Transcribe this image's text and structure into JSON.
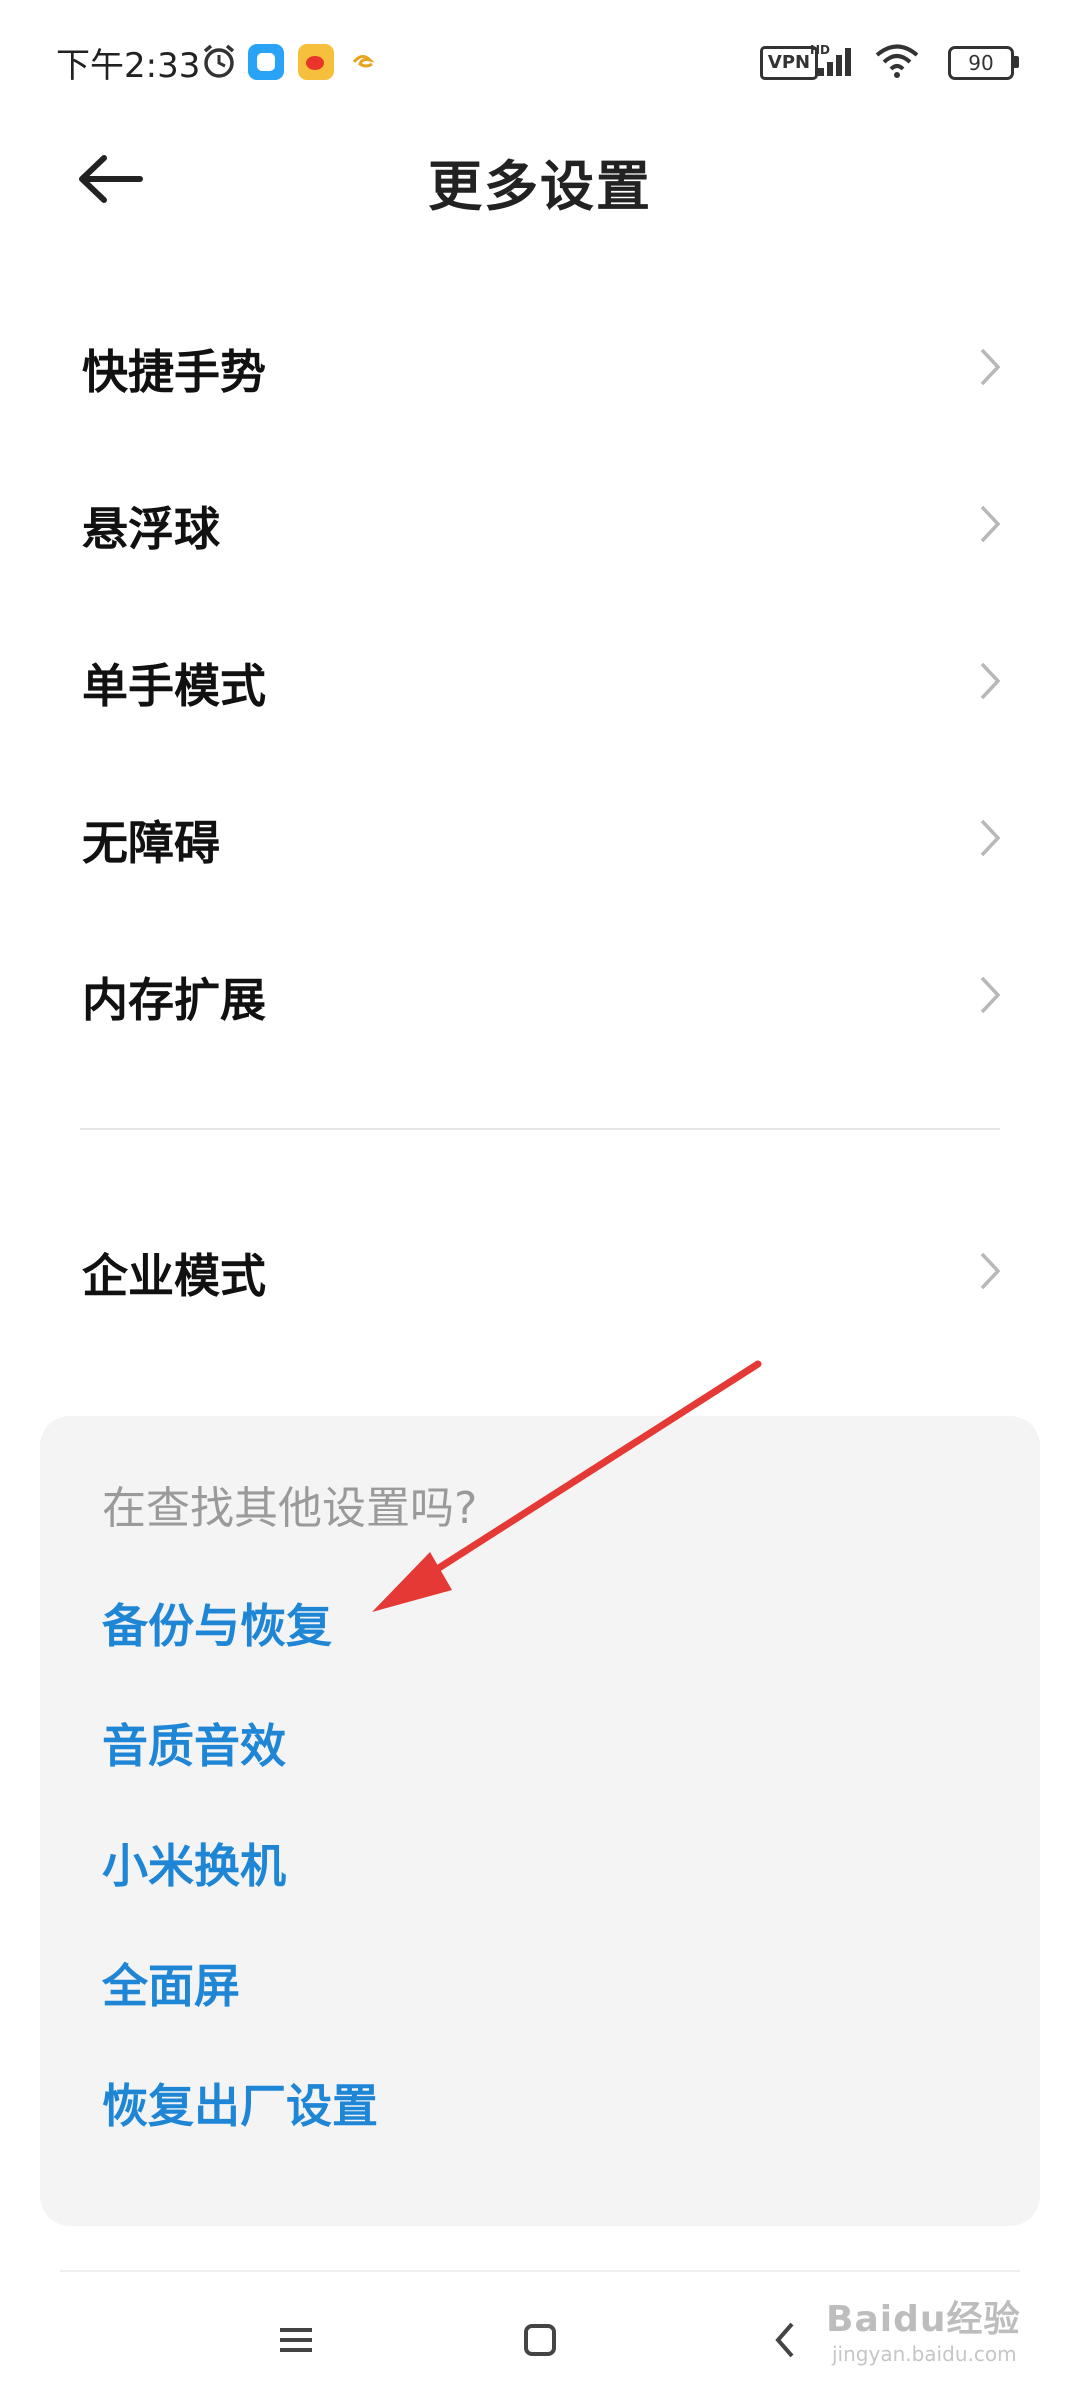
{
  "status_bar": {
    "time": "下午2:33",
    "vpn_label": "VPN",
    "hd_label": "HD",
    "battery": "90",
    "icons": [
      "alarm-icon",
      "blue-app-icon",
      "weibo-icon",
      "yellow-app-icon",
      "signal-icon",
      "wifi-icon",
      "battery-icon"
    ]
  },
  "header": {
    "title": "更多设置",
    "back_icon": "arrow-left-icon"
  },
  "settings": [
    {
      "label": "快捷手势"
    },
    {
      "label": "悬浮球"
    },
    {
      "label": "单手模式"
    },
    {
      "label": "无障碍"
    },
    {
      "label": "内存扩展"
    }
  ],
  "enterprise": {
    "label": "企业模式"
  },
  "suggestions": {
    "hint": "在查找其他设置吗?",
    "links": [
      "备份与恢复",
      "音质音效",
      "小米换机",
      "全面屏",
      "恢复出厂设置"
    ]
  },
  "watermark": {
    "brand": "Baidu经验",
    "url": "jingyan.baidu.com"
  },
  "colors": {
    "link": "#1f86d6",
    "annotation_arrow": "#e53935",
    "card_bg": "#f4f4f4"
  }
}
